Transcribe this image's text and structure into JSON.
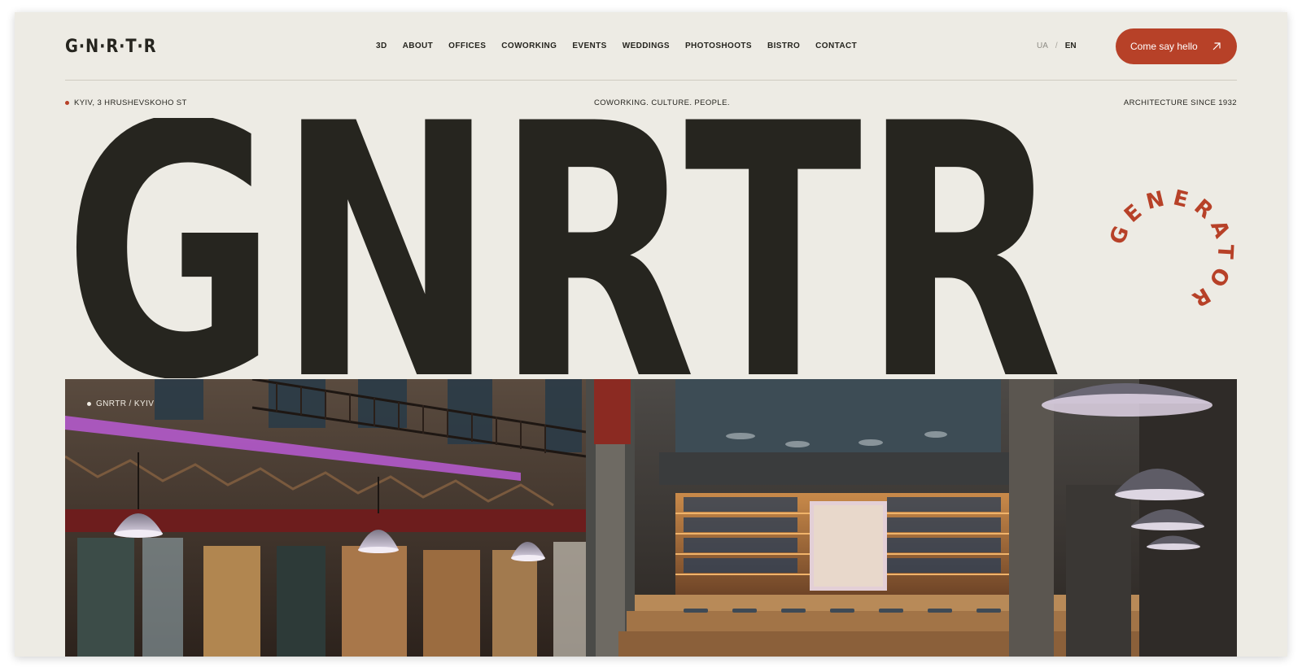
{
  "header": {
    "logo": "G·N·R·T·R",
    "nav": [
      "3D",
      "ABOUT",
      "OFFICES",
      "COWORKING",
      "EVENTS",
      "WEDDINGS",
      "PHOTOSHOOTS",
      "BISTRO",
      "CONTACT"
    ],
    "lang_ua": "UA",
    "lang_sep": "/",
    "lang_en": "EN",
    "cta_label": "Come say hello",
    "cta_icon": "arrow-up-right-icon"
  },
  "info": {
    "address": "KYIV, 3 HRUSHEVSKOHO ST",
    "tagline": "COWORKING. CULTURE. PEOPLE.",
    "since": "ARCHITECTURE SINCE 1932"
  },
  "hero": {
    "title": "GNRTR",
    "ring_text": "GENERATOR"
  },
  "photo": {
    "label": "GNRTR / KYIV",
    "alt": "Interior of GNRTR coworking space"
  },
  "colors": {
    "background": "#edebe4",
    "ink": "#26251f",
    "accent": "#b74128"
  }
}
